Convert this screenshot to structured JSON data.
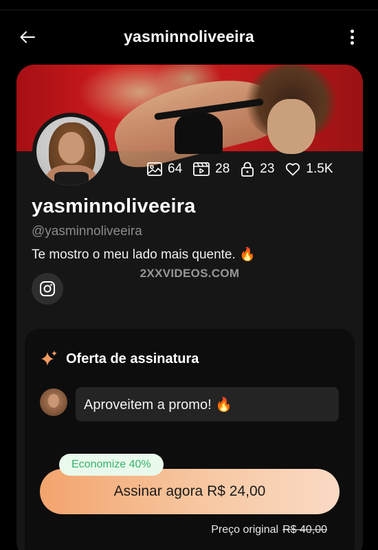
{
  "header": {
    "title": "yasminnoliveeira",
    "back_icon": "arrow-left-icon",
    "menu_icon": "more-vertical-icon"
  },
  "profile": {
    "name": "yasminnoliveeira",
    "handle": "@yasminnoliveeira",
    "bio": "Te mostro o meu lado mais quente. 🔥",
    "watermark": "2XXVIDEOS.COM",
    "social_icon": "instagram-icon"
  },
  "stats": [
    {
      "icon": "image-icon",
      "value": "64"
    },
    {
      "icon": "video-icon",
      "value": "28"
    },
    {
      "icon": "lock-icon",
      "value": "23"
    },
    {
      "icon": "heart-icon",
      "value": "1.5K"
    }
  ],
  "offer": {
    "title": "Oferta de assinatura",
    "title_icon": "sparkle-icon",
    "message": "Aproveitem a promo! 🔥",
    "badge": "Economize 40%",
    "button_label": "Assinar agora R$ 24,00",
    "original_label": "Preço original",
    "original_price": "R$ 40,00"
  },
  "colors": {
    "background": "#000000",
    "card": "#161616",
    "offer_bg": "#0d0d0d",
    "button_gradient_start": "#f3a46d",
    "button_gradient_end": "#fad9c4",
    "badge_bg": "#e9f9ec",
    "badge_text": "#35b26c",
    "sparkle": "#f29a5e"
  }
}
